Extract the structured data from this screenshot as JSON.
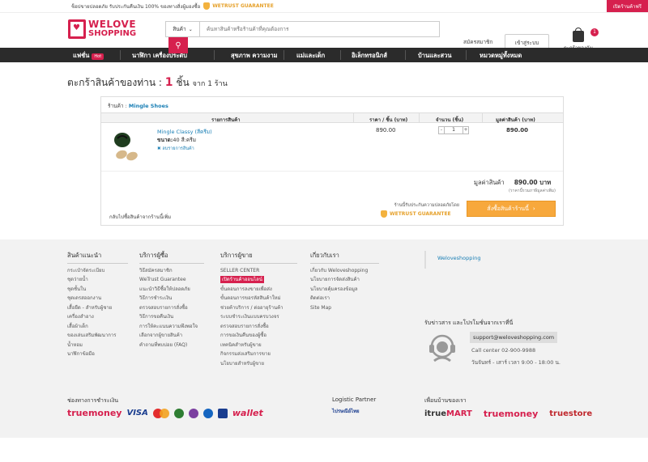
{
  "topbar": {
    "text": "ช็อปขายปลอดภัย รับประกันคืนเงิน 100% ของทางสิ่งผู้มองซื้อ",
    "wetrust": "WETRUST GUARANTEE",
    "open_shop": "เปิดร้านค้าฟรี"
  },
  "logo": {
    "line1": "WELOVE",
    "line2": "SHOPPING"
  },
  "search": {
    "category": "สินค้า",
    "placeholder": "ค้นหาสินค้าหรือร้านค้าที่คุณต้องการ"
  },
  "header": {
    "register": "สมัครสมาชิก",
    "login": "เข้าสู่ระบบ",
    "cart_label": "ตะกร้าของฉัน",
    "cart_count": "1"
  },
  "nav": {
    "items": [
      "แฟชั่น",
      "นาฬิกา เครื่องประดับ",
      "สุขภาพ ความงาม",
      "แม่และเด็ก",
      "อิเล็กทรอนิกส์",
      "บ้านและสวน",
      "หมวดหมู่ทั้งหมด"
    ],
    "hot": "Hot"
  },
  "page": {
    "title_prefix": "ตะกร้าสินค้าของท่าน :",
    "count": "1",
    "title_unit": "ชิ้น",
    "title_suffix": "จาก 1 ร้าน"
  },
  "cart": {
    "shop_label": "ร้านค้า :",
    "shop_name": "Mingle Shoes",
    "columns": [
      "รายการสินค้า",
      "ราคา / ชิ้น (บาท)",
      "จำนวน (ชิ้น)",
      "มูลค่าสินค้า (บาท)"
    ],
    "item": {
      "name": "Mingle Classy (สีครีม)",
      "size_label": "ขนาด:",
      "size_value": "40 สี:ครีม",
      "remove": "ลบรายการสินค้า",
      "price": "890.00",
      "qty": "1",
      "total": "890.00"
    },
    "subtotal_label": "มูลค่าสินค้า",
    "subtotal_value": "890.00 บาท",
    "vat_note": "(ราคานี้รวมภาษีมูลค่าเพิ่ม)",
    "guarantee_text": "ร้านนี้รับประกันความปลอดภัยโดย",
    "guarantee_badge": "WETRUST GUARANTEE",
    "checkout": "สั่งซื้อสินค้าร้านนี้",
    "back": "กลับไปซื้อสินค้าจากร้านนี้เพิ่ม"
  },
  "footer": {
    "col1": {
      "title": "สินค้าแนะนำ",
      "links": [
        "กระเป๋าจัดระเบียบ",
        "ชุดว่ายน้ำ",
        "ชุดชั้นใน",
        "ชุดเดรสออกงาน",
        "เสื้อยืด - สำหรับผู้ชาย",
        "เครื่องสำอาง",
        "เสื้อผ้าเด็ก",
        "ของเล่นเสริมพัฒนาการ",
        "น้ำหอม",
        "นาฬิกาข้อมือ"
      ]
    },
    "col2": {
      "title": "บริการผู้ซื้อ",
      "links": [
        "วิธีสมัครสมาชิก",
        "WeTrust Guarantee",
        "แนะนำวิธีซื้อให้ปลอดภัย",
        "วิธีการชำระเงิน",
        "ตรวจสอบรายการสั่งซื้อ",
        "วิธีการขอคืนเงิน",
        "การให้คะแนนความพึงพอใจ",
        "เลือกจากผู้ขายสินค้า",
        "คำถามที่พบบ่อย (FAQ)"
      ]
    },
    "col3": {
      "title": "บริการผู้ขาย",
      "links": [
        "SELLER CENTER",
        "เปิดร้านค้าออนไลน์",
        "ขั้นตอนการลงขายเพื่อส่ง",
        "ขั้นตอนการขอรหัสสินค้าใหม่",
        "ช่วยค้าบริการ / ต่ออายุร้านค้า",
        "ระบบชำระเงินแบบครบวงจร",
        "ตรวจสอบรายการสั่งซื้อ",
        "การขอเงินคืนของผู้ซื้อ",
        "เทคนิคสำหรับผู้ขาย",
        "กิจกรรมส่งเสริมการขาย",
        "นโยบายสำหรับผู้ขาย"
      ]
    },
    "col4": {
      "title": "เกี่ยวกับเรา",
      "links": [
        "เกี่ยวกับ Weloveshopping",
        "นโยบายการจัดส่งสินค้า",
        "นโยบายคุ้มครองข้อมูล",
        "ติดต่อเรา",
        "Site Map"
      ]
    },
    "facebook": "Weloveshopping",
    "newsletter": "รับข่าวสาร และโปรโมชั่นจากเราที่นี่",
    "support_email": "support@weloveshopping.com",
    "callcenter": "Call center 02-900-9988",
    "hours": "วันจันทร์ - เสาร์ เวลา 9:00 - 18:00 น.",
    "payment_title": "ช่องทางการชำระเงิน",
    "payment": {
      "truemoney": "truemoney",
      "visa": "VISA",
      "wallet": "wallet"
    },
    "logistic_title": "Logistic Partner",
    "logistic": "ไปรษณีย์ไทย",
    "friends_title": "เพื่อนบ้านของเรา",
    "friends": {
      "itrue_a": "itrue",
      "itrue_b": "MART",
      "truemoney": "truemoney",
      "truestore": "truestore"
    }
  },
  "colors": {
    "accent": "#d6204e",
    "checkout": "#f7a83c",
    "link": "#1a7fb5",
    "nav": "#2b2b2b"
  }
}
